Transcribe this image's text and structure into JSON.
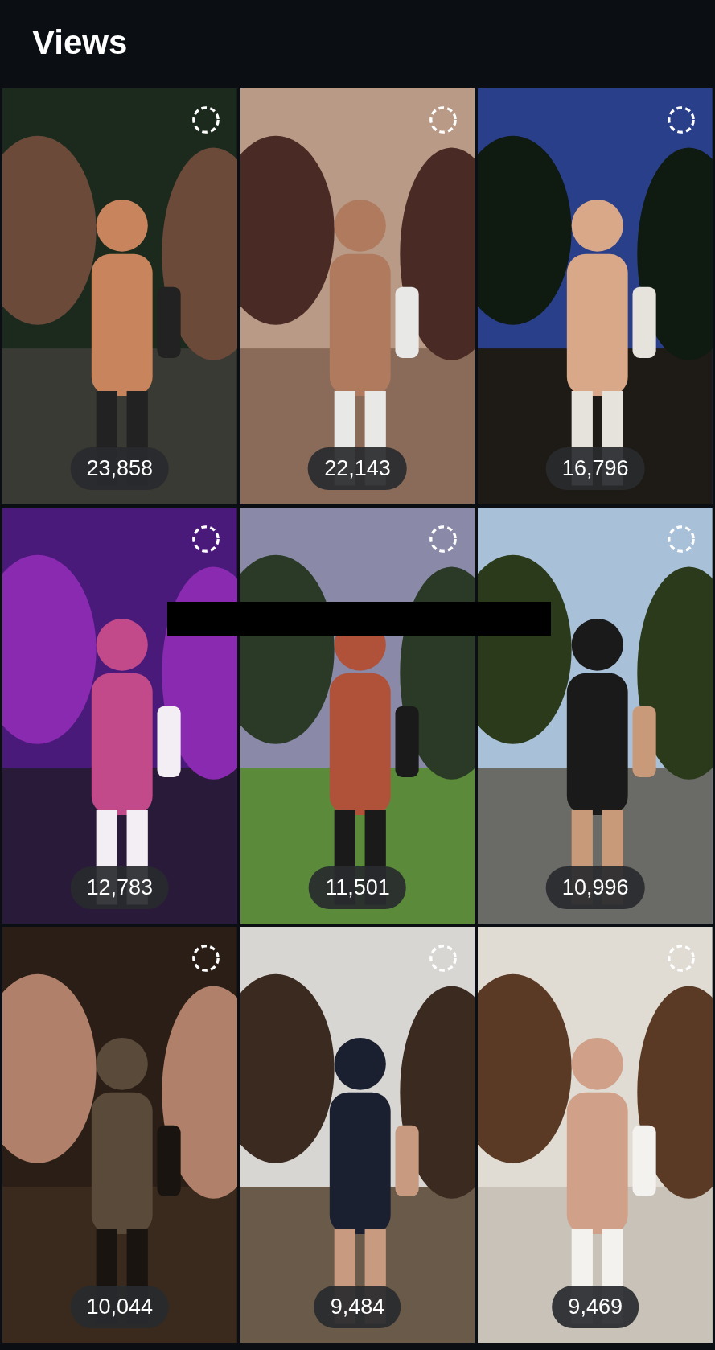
{
  "header": {
    "title": "Views"
  },
  "tiles": [
    {
      "kind": "picture",
      "views": "23,858"
    },
    {
      "kind": "picture",
      "views": "22,143"
    },
    {
      "kind": "picture",
      "views": "16,796"
    },
    {
      "kind": "picture",
      "views": "12,783"
    },
    {
      "kind": "picture",
      "views": "11,501"
    },
    {
      "kind": "picture",
      "views": "10,996"
    },
    {
      "kind": "picture",
      "views": "10,044"
    },
    {
      "kind": "picture",
      "views": "9,484"
    },
    {
      "kind": "picture",
      "views": "9,469"
    }
  ]
}
